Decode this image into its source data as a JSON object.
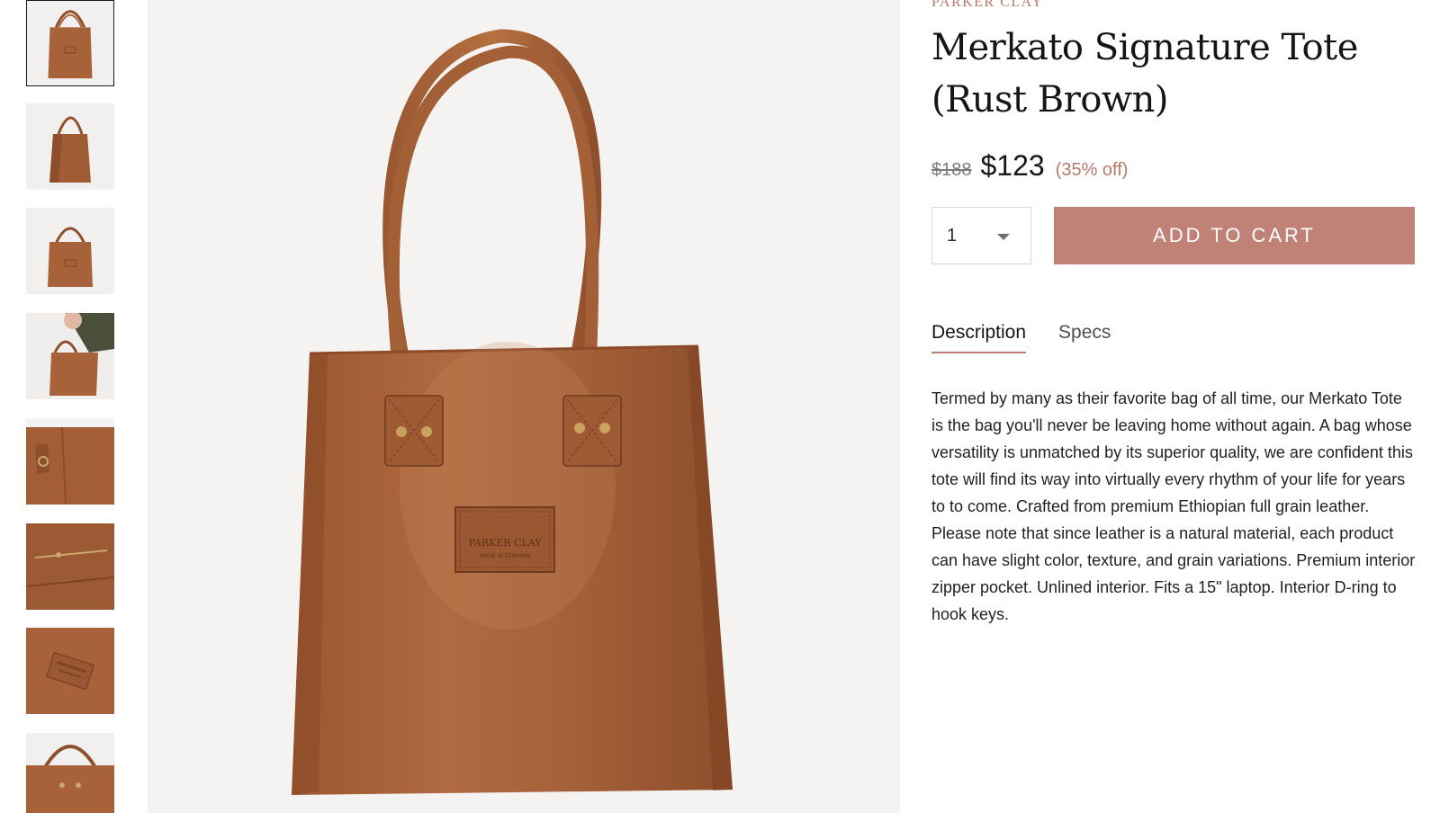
{
  "brand": "PARKER CLAY",
  "product": {
    "title": "Merkato Signature Tote (Rust Brown)",
    "price_original": "$188",
    "price_sale": "$123",
    "discount": "(35% off)",
    "quantity": "1",
    "add_to_cart_label": "ADD TO CART"
  },
  "tabs": [
    {
      "label": "Description",
      "active": true
    },
    {
      "label": "Specs",
      "active": false
    }
  ],
  "description": "Termed by many as their favorite bag of all time, our Merkato Tote is the bag you'll never be leaving home without again. A bag whose versatility is unmatched by its superior quality, we are confident this tote will find its way into virtually every rhythm of your life for years to to come. Crafted from premium Ethiopian full grain leather. Please note that since leather is a natural material, each product can have slight color, texture, and grain variations. Premium interior zipper pocket. Unlined interior. Fits a 15\" laptop. Interior D-ring to hook keys.",
  "main_image": {
    "patch_line1": "PARKER CLAY",
    "patch_line2": "MADE IN ETHIOPIA"
  },
  "thumbnails": [
    {
      "view": "front"
    },
    {
      "view": "angled"
    },
    {
      "view": "front-small"
    },
    {
      "view": "worn-on-shoulder"
    },
    {
      "view": "interior-d-ring"
    },
    {
      "view": "interior-zipper-pocket"
    },
    {
      "view": "logo-patch-closeup"
    },
    {
      "view": "side-detail"
    }
  ],
  "colors": {
    "accent": "#c08176",
    "brand_text": "#b77a6d",
    "leather": "#a8623a"
  }
}
